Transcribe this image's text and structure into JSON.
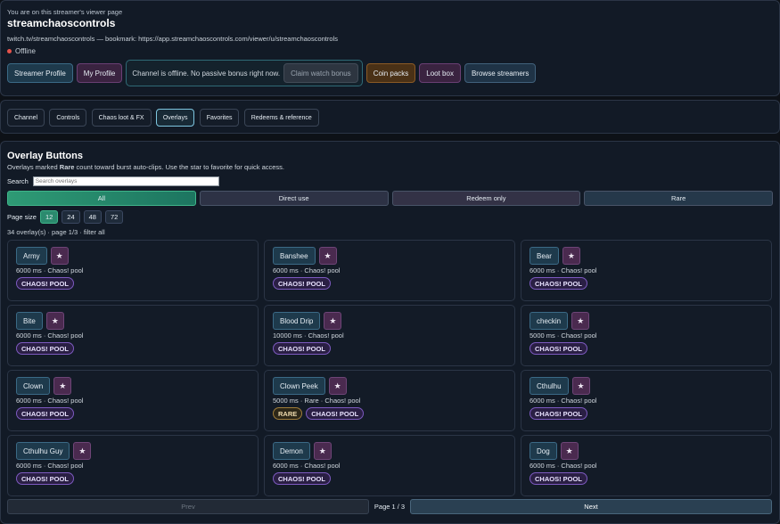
{
  "header": {
    "hint": "You are on this streamer's viewer page",
    "streamer": "streamchaoscontrols",
    "subline": "twitch.tv/streamchaoscontrols — bookmark: https://app.streamchaoscontrols.com/viewer/u/streamchaoscontrols",
    "status": "Offline"
  },
  "toolbar": {
    "streamer_profile": "Streamer Profile",
    "my_profile": "My Profile",
    "offline_message": "Channel is offline. No passive bonus right now.",
    "claim_watch_bonus": "Claim watch bonus",
    "coin_packs": "Coin packs",
    "loot_box": "Loot box",
    "browse_streamers": "Browse streamers"
  },
  "tabs": [
    {
      "label": "Channel"
    },
    {
      "label": "Controls"
    },
    {
      "label": "Chaos loot & FX"
    },
    {
      "label": "Overlays",
      "active": true
    },
    {
      "label": "Favorites"
    },
    {
      "label": "Redeems & reference"
    }
  ],
  "overlays": {
    "title": "Overlay Buttons",
    "desc_pre": "Overlays marked ",
    "desc_bold": "Rare",
    "desc_post": " count toward burst auto-clips. Use the star to favorite for quick access.",
    "search_label": "Search",
    "search_placeholder": "Search overlays",
    "search_value": "",
    "filters": [
      "All",
      "Direct use",
      "Redeem only",
      "Rare"
    ],
    "page_size_label": "Page size",
    "page_sizes": [
      "12",
      "24",
      "48",
      "72"
    ],
    "page_size_selected": "12",
    "count_text": "34 overlay(s) · page 1/3 · filter all",
    "star_glyph": "★",
    "items": [
      {
        "name": "Army",
        "meta": "6000 ms · Chaos! pool",
        "badges": [
          "CHAOS! POOL"
        ]
      },
      {
        "name": "Banshee",
        "meta": "6000 ms · Chaos! pool",
        "badges": [
          "CHAOS! POOL"
        ]
      },
      {
        "name": "Bear",
        "meta": "6000 ms · Chaos! pool",
        "badges": [
          "CHAOS! POOL"
        ]
      },
      {
        "name": "Bite",
        "meta": "6000 ms · Chaos! pool",
        "badges": [
          "CHAOS! POOL"
        ]
      },
      {
        "name": "Blood Drip",
        "meta": "10000 ms · Chaos! pool",
        "badges": [
          "CHAOS! POOL"
        ]
      },
      {
        "name": "checkin",
        "meta": "5000 ms · Chaos! pool",
        "badges": [
          "CHAOS! POOL"
        ]
      },
      {
        "name": "Clown",
        "meta": "6000 ms · Chaos! pool",
        "badges": [
          "CHAOS! POOL"
        ]
      },
      {
        "name": "Clown Peek",
        "meta": "5000 ms · Rare · Chaos! pool",
        "badges": [
          "RARE",
          "CHAOS! POOL"
        ]
      },
      {
        "name": "Cthulhu",
        "meta": "6000 ms · Chaos! pool",
        "badges": [
          "CHAOS! POOL"
        ]
      },
      {
        "name": "Cthulhu Guy",
        "meta": "6000 ms · Chaos! pool",
        "badges": [
          "CHAOS! POOL"
        ]
      },
      {
        "name": "Demon",
        "meta": "6000 ms · Chaos! pool",
        "badges": [
          "CHAOS! POOL"
        ]
      },
      {
        "name": "Dog",
        "meta": "6000 ms · Chaos! pool",
        "badges": [
          "CHAOS! POOL"
        ]
      }
    ],
    "pager": {
      "prev": "Prev",
      "label": "Page 1 / 3",
      "next": "Next"
    }
  }
}
